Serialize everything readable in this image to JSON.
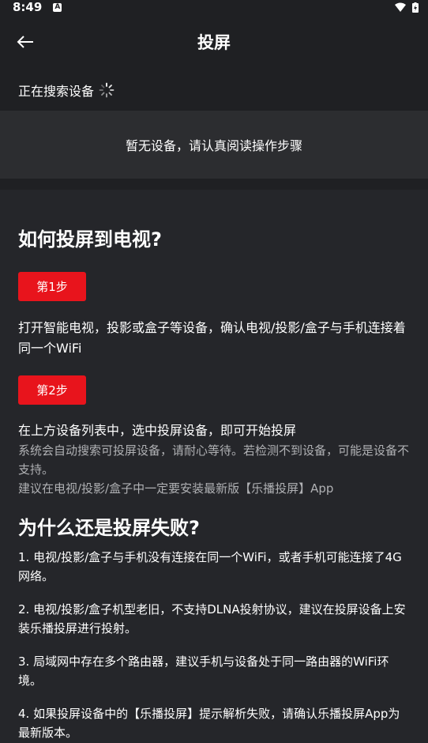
{
  "status_bar": {
    "time": "8:49",
    "notif_letter": "A"
  },
  "header": {
    "title": "投屏"
  },
  "search": {
    "status": "正在搜索设备"
  },
  "device_list": {
    "empty_message": "暂无设备，请认真阅读操作步骤"
  },
  "how_to": {
    "title": "如何投屏到电视?",
    "step1_label": "第1步",
    "step1_text": "打开智能电视，投影或盒子等设备，确认电视/投影/盒子与手机连接着同一个WiFi",
    "step2_label": "第2步",
    "step2_text": "在上方设备列表中，选中投屏设备，即可开始投屏",
    "note1": "系统会自动搜索可投屏设备，请耐心等待。若检测不到设备，可能是设备不支持。",
    "note2": "建议在电视/投影/盒子中一定要安装最新版【乐播投屏】App"
  },
  "faq": {
    "title": "为什么还是投屏失败?",
    "items": [
      "1. 电视/投影/盒子与手机没有连接在同一个WiFi，或者手机可能连接了4G网络。",
      " 2. 电视/投影/盒子机型老旧，不支持DLNA投射协议，建议在投屏设备上安装乐播投屏进行投射。",
      " 3. 局域网中存在多个路由器，建议手机与设备处于同一路由器的WiFi环境。",
      " 4. 如果投屏设备中的【乐播投屏】提示解析失败，请确认乐播投屏App为最新版本。"
    ]
  }
}
